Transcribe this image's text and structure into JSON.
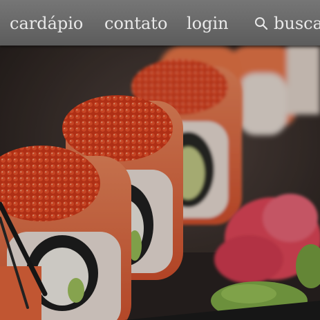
{
  "nav": {
    "items": [
      {
        "label": "cardápio"
      },
      {
        "label": "contato"
      },
      {
        "label": "login"
      }
    ],
    "search": {
      "label": "busca",
      "icon": "search-icon"
    }
  },
  "colors": {
    "navbar": "#6b6b6b",
    "nav_text": "#e9e9e9",
    "salmon": "#e8643a",
    "roe": "#e23b1c",
    "rice": "#f2e6df",
    "ginger": "#e84a5c",
    "leaf": "#7fae42"
  }
}
